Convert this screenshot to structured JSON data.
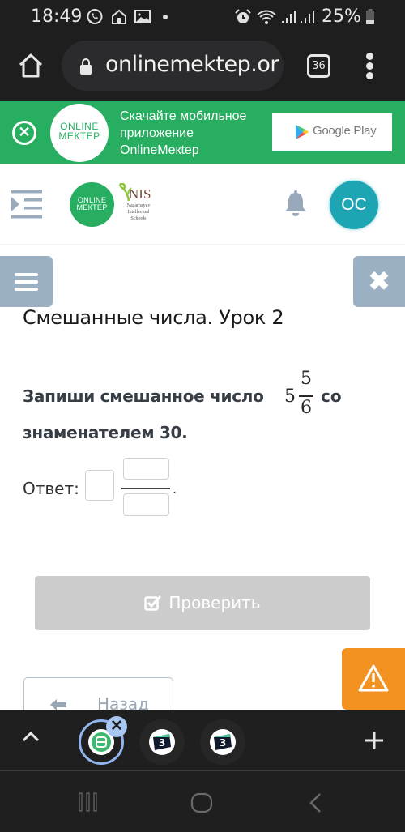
{
  "status_bar": {
    "time": "18:49",
    "battery_percent": "25%",
    "left_icons": [
      "whatsapp-icon",
      "home-app-icon",
      "gallery-icon",
      "dot-icon"
    ],
    "right_icons": [
      "alarm-icon",
      "wifi-icon",
      "signal-icon",
      "signal-icon",
      "battery-icon"
    ],
    "battery_level": 0.25
  },
  "browser": {
    "url": "onlinemektep.org",
    "tab_count": "36",
    "icons": [
      "home-icon",
      "lock-icon",
      "more-vert-icon"
    ]
  },
  "promo_banner": {
    "logo_line1": "ONLINE",
    "logo_line2": "МЕКТЕР",
    "text_line1": "Скачайте мобильное",
    "text_line2": "приложение",
    "text_line3": "OnlineMeкtep",
    "store_label": "Google Play",
    "bg_color": "#27ae60"
  },
  "site_header": {
    "logo_line1": "ONLINE",
    "logo_line2": "МЕКТЕР",
    "nis_title": "NIS",
    "nis_line1": "Nazarbayev",
    "nis_line2": "Intellectual",
    "nis_line3": "Schools",
    "avatar_initials": "OC",
    "avatar_color": "#1da5b3"
  },
  "lesson": {
    "title": "Смешанные числа. Урок 2",
    "task_prefix": "Запиши смешанное число",
    "mixed_number": {
      "whole": "5",
      "numerator": "5",
      "denominator": "6"
    },
    "task_suffix": "со",
    "task_line2": "знаменателем 30.",
    "answer_label": "Ответ:",
    "answer": {
      "whole": "",
      "numerator": "",
      "denominator": ""
    },
    "answer_end": ".",
    "check_label": "Проверить",
    "back_label": "Назад"
  },
  "tab_strip": {
    "tabs": [
      {
        "icon": "bilimland-icon",
        "active": true
      },
      {
        "icon": "tab-3-icon",
        "active": false
      },
      {
        "icon": "tab-3-icon",
        "active": false
      }
    ]
  },
  "colors": {
    "float_buttons": "#9bb1c3",
    "check_disabled": "#cccccc",
    "warning": "#f39121"
  }
}
